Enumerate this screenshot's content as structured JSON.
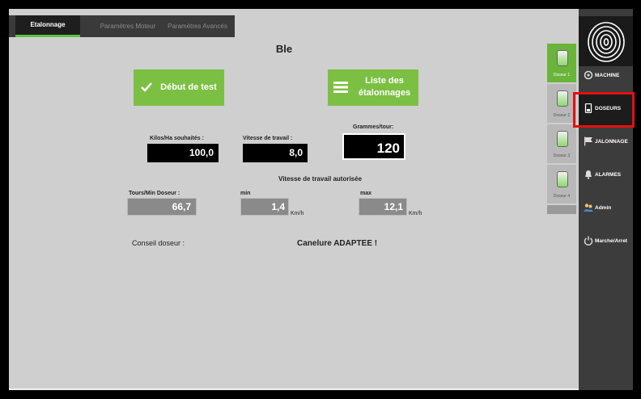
{
  "tabs": [
    {
      "label": "Etalonnage",
      "active": true
    },
    {
      "label": "Paramètres Moteur",
      "active": false
    },
    {
      "label": "Paramètres Avancés",
      "active": false
    }
  ],
  "page_title": "Ble",
  "buttons": {
    "start_test": "Début de test",
    "list_line1": "Liste des",
    "list_line2": "étalonnages"
  },
  "fields": {
    "kilos_label": "Kilos/Ha souhaités :",
    "kilos_value": "100,0",
    "speed_label": "Vitesse de travail :",
    "speed_value": "8,0",
    "grams_label": "Grammes/tour:",
    "grams_value": "120",
    "allowed_speed_label": "Vitesse de travail autorisée",
    "tours_label": "Tours/Min Doseur :",
    "tours_value": "66,7",
    "min_label": "min",
    "min_value": "1,4",
    "max_label": "max",
    "max_value": "12,1",
    "unit_kmh": "Km/h"
  },
  "advice": {
    "label": "Conseil doseur :",
    "value": "Canelure ADAPTEE !"
  },
  "doseurs": [
    {
      "label": "Doseur 1",
      "active": true
    },
    {
      "label": "Doseur 2",
      "active": false
    },
    {
      "label": "Doseur 3",
      "active": false
    },
    {
      "label": "Doseur 4",
      "active": false
    }
  ],
  "sidebar": [
    {
      "label": "MACHINE",
      "icon": "gear-icon"
    },
    {
      "label": "DOSEURS",
      "icon": "hopper-icon",
      "active": true
    },
    {
      "label": "JALONNAGE",
      "icon": "flag-icon"
    },
    {
      "label": "ALARMES",
      "icon": "bell-icon"
    },
    {
      "label": "Admin",
      "icon": "users-icon"
    },
    {
      "label": "Marche/Arret",
      "icon": "power-icon"
    }
  ],
  "colors": {
    "accent": "#7cc043",
    "highlight": "#e41010",
    "sidebar": "#3c3c3c"
  }
}
